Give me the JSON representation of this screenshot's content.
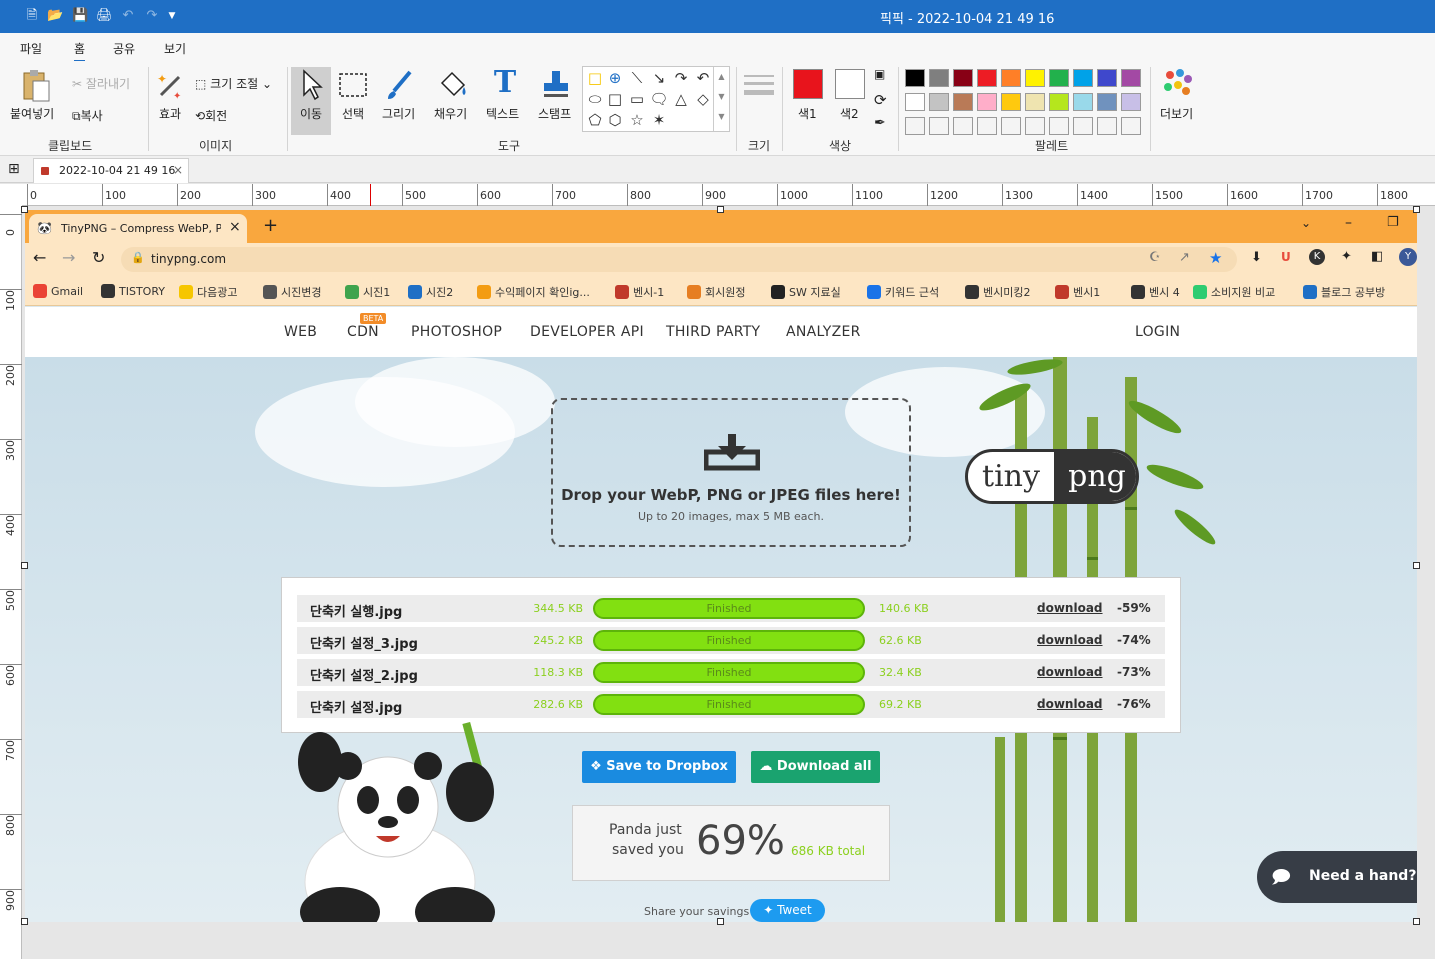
{
  "app": {
    "title": "픽픽 - 2022-10-04 21 49 16",
    "menu": [
      "파일",
      "홈",
      "공유",
      "보기"
    ]
  },
  "ribbon": {
    "clipboard": {
      "paste": "붙여넣기",
      "cut": "잘라내기",
      "copy": "복사",
      "group": "클립보드"
    },
    "image": {
      "effect": "효과",
      "resize": "크기 조절",
      "rotate": "회전",
      "group": "이미지"
    },
    "tools": {
      "move": "이동",
      "select": "선택",
      "draw": "그리기",
      "fill": "채우기",
      "text": "텍스트",
      "stamp": "스탬프",
      "group": "도구"
    },
    "size": {
      "group": "크기"
    },
    "color": {
      "color1": "색1",
      "color2": "색2",
      "group": "색상",
      "color1_value": "#e8141c",
      "color2_value": "#ffffff"
    },
    "palette": {
      "group": "팔레트",
      "row1": [
        "#000000",
        "#7f7f7f",
        "#880015",
        "#ed1c24",
        "#ff7f27",
        "#fff200",
        "#22b14c",
        "#00a2e8",
        "#3f48cc",
        "#a349a4"
      ],
      "row2": [
        "#ffffff",
        "#c3c3c3",
        "#b97a57",
        "#ffaec9",
        "#ffc90e",
        "#efe4b0",
        "#b5e61d",
        "#99d9ea",
        "#7092be",
        "#c8bfe7"
      ]
    },
    "more": "더보기"
  },
  "document_tab": {
    "label": "2022-10-04 21 49 16"
  },
  "ruler": {
    "h_labels": [
      "0",
      "100",
      "200",
      "300",
      "400",
      "500",
      "600",
      "700",
      "800",
      "900",
      "1000",
      "1100",
      "1200",
      "1300",
      "1400",
      "1500",
      "1600",
      "1700",
      "1800"
    ],
    "v_labels": [
      "0",
      "100",
      "200",
      "300",
      "400",
      "500",
      "600",
      "700",
      "800",
      "900"
    ]
  },
  "browser": {
    "tab_title": "TinyPNG – Compress WebP, PN",
    "url": "tinypng.com",
    "bookmarks": [
      "Gmail",
      "TISTORY",
      "다음광고",
      "시진변경",
      "시진1",
      "시진2",
      "수익페이지 확인ig...",
      "벤시-1",
      "회시원정",
      "SW 지료실",
      "키워드 근석",
      "벤시미킹2",
      "벤시1",
      "벤시 4",
      "소비지원 비교",
      "블로그 공부방"
    ]
  },
  "site": {
    "nav": [
      "WEB",
      "CDN",
      "PHOTOSHOP",
      "DEVELOPER API",
      "THIRD PARTY",
      "ANALYZER"
    ],
    "beta": "BETA",
    "login": "LOGIN",
    "drop_title": "Drop your WebP, PNG or JPEG files here!",
    "drop_sub": "Up to 20 images, max 5 MB each.",
    "logo_left": "tiny",
    "logo_right": "png",
    "results": [
      {
        "name": "단축키 실행.jpg",
        "original": "344.5 KB",
        "status": "Finished",
        "new": "140.6 KB",
        "link": "download",
        "saving": "-59%"
      },
      {
        "name": "단축키 설정_3.jpg",
        "original": "245.2 KB",
        "status": "Finished",
        "new": "62.6 KB",
        "link": "download",
        "saving": "-74%"
      },
      {
        "name": "단축키 설정_2.jpg",
        "original": "118.3 KB",
        "status": "Finished",
        "new": "32.4 KB",
        "link": "download",
        "saving": "-73%"
      },
      {
        "name": "단축키 설정.jpg",
        "original": "282.6 KB",
        "status": "Finished",
        "new": "69.2 KB",
        "link": "download",
        "saving": "-76%"
      }
    ],
    "dropbox_btn": "Save to Dropbox",
    "download_all": "Download all",
    "savings_line1": "Panda just",
    "savings_line2": "saved you",
    "savings_pct": "69%",
    "savings_total": "686 KB total",
    "share": "Share your savings",
    "tweet": "Tweet",
    "help": "Need a hand?"
  }
}
